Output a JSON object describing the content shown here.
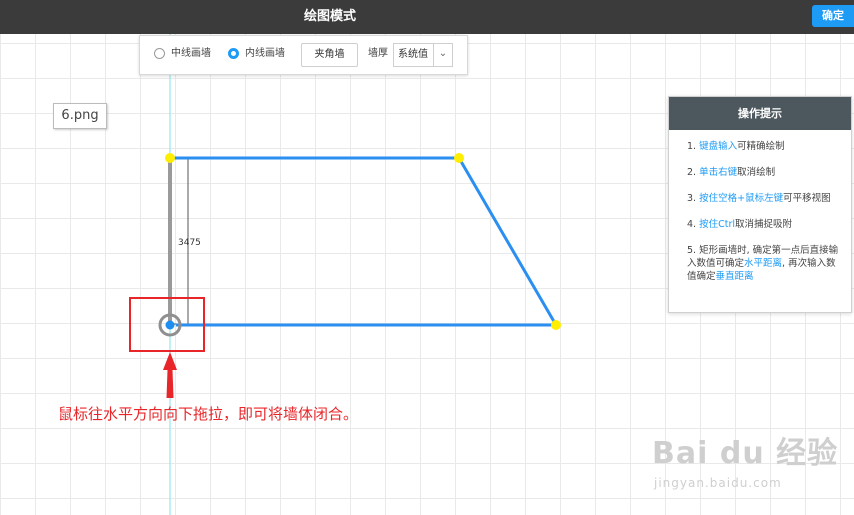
{
  "topbar": {
    "title": "绘图模式",
    "confirm_label": "确定"
  },
  "toolbar": {
    "radio_center": {
      "label": "中线画墙",
      "selected": false
    },
    "radio_inner": {
      "label": "内线画墙",
      "selected": true
    },
    "corner_wall_label": "夹角墙",
    "thickness_label": "墙厚",
    "thickness_value": "系统值"
  },
  "file_label": "6.png",
  "tips": {
    "title": "操作提示",
    "items": [
      {
        "num": "1.",
        "hl": "键盘输入",
        "rest": "可精确绘制"
      },
      {
        "num": "2.",
        "hl": "单击右键",
        "rest": "取消绘制"
      },
      {
        "num": "3.",
        "hl": "按住空格+鼠标左键",
        "rest": "可平移视图"
      },
      {
        "num": "4.",
        "hl": "按住Ctrl",
        "rest": "取消捕捉吸附"
      },
      {
        "num": "5.",
        "text1": "矩形画墙时, 确定第一点后直接输入数值可确定",
        "hl1": "水平距离",
        "text2": ", 再次输入数值确定",
        "hl2": "垂直距离"
      }
    ]
  },
  "dimension_label": "3475",
  "annotation": "鼠标往水平方向向下拖拉，即可将墙体闭合。",
  "watermark": {
    "logo": "Bai du 经验",
    "sub": "jingyan.baidu.com"
  },
  "colors": {
    "wall": "#2a8ff0",
    "vertex": "#ffee00",
    "guide": "#7fe3ea",
    "highlight": "#e8262a",
    "accent": "#1e9bf5"
  }
}
